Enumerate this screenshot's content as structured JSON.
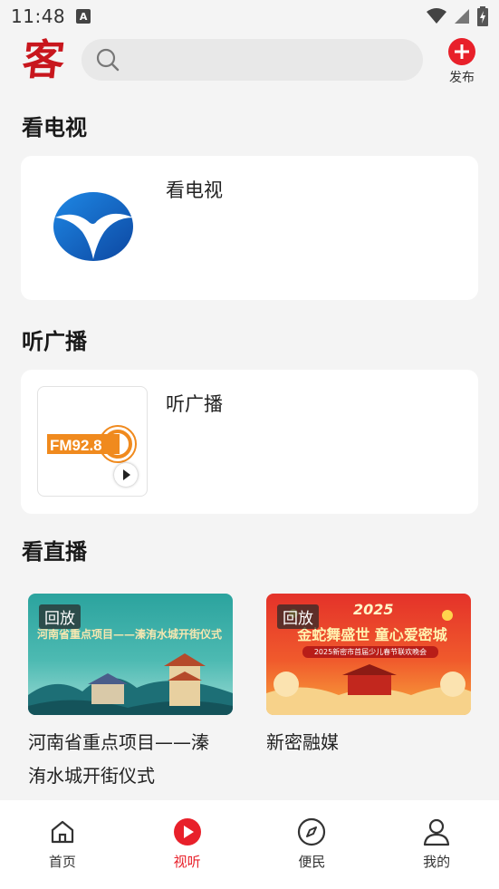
{
  "status_bar": {
    "time": "11:48",
    "notification_letter": "A"
  },
  "header": {
    "logo_char": "客",
    "search": {
      "placeholder": "",
      "value": ""
    },
    "publish_label": "发布"
  },
  "sections": {
    "tv": {
      "title": "看电视",
      "card_label": "看电视"
    },
    "radio": {
      "title": "听广播",
      "card_label": "听广播",
      "fm_text": "FM92.8"
    },
    "live": {
      "title": "看直播",
      "items": [
        {
          "badge": "回放",
          "thumb_text": "河南省重点项目——溱洧水城开街仪式",
          "title_line1": "河南省重点项目——溱",
          "title_line2": "洧水城开街仪式"
        },
        {
          "badge": "回放",
          "thumb_year": "2025",
          "thumb_text": "金蛇舞盛世 童心爱密城",
          "thumb_subtext": "2025新密市首届少儿春节联欢晚会",
          "title_line1": "新密融媒",
          "title_line2": ""
        }
      ]
    }
  },
  "bottom_nav": {
    "active": "视听",
    "items": [
      {
        "label": "首页",
        "icon": "home-icon"
      },
      {
        "label": "视听",
        "icon": "play-icon"
      },
      {
        "label": "便民",
        "icon": "compass-icon"
      },
      {
        "label": "我的",
        "icon": "user-icon"
      }
    ]
  },
  "colors": {
    "accent": "#e8202a",
    "logo_red": "#c8161d",
    "fm_orange": "#f08a1e",
    "tv_blue": "#1565c0"
  }
}
